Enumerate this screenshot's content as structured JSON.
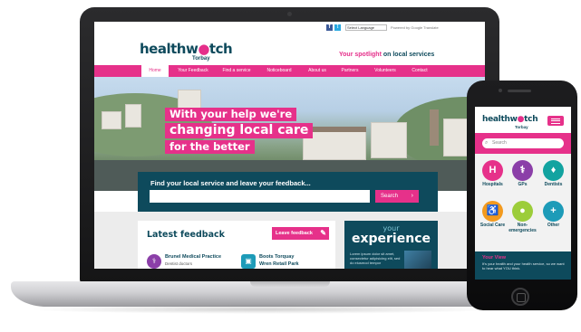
{
  "desktop": {
    "social": {
      "facebook": "f",
      "twitter": "t"
    },
    "language_select": "Select Language",
    "google_translate": "Powered by Google Translate",
    "logo": {
      "part1": "healthw",
      "mark": "●",
      "part2": "tch",
      "sub": "Torbay"
    },
    "tagline": {
      "highlight": "Your spotlight",
      "rest": " on local services"
    },
    "nav": [
      "Home",
      "Your Feedback",
      "Find a service",
      "Noticeboard",
      "About us",
      "Partners",
      "Volunteers",
      "Contact"
    ],
    "hero": {
      "line1": "With your help we're",
      "line2": "changing local care",
      "line3": "for the better"
    },
    "search": {
      "label": "Find your local service and leave your feedback...",
      "placeholder": "",
      "button": "Search",
      "button_chevron": "›"
    },
    "feedback": {
      "title": "Latest feedback",
      "leave_button": "Leave feedback",
      "entries": [
        {
          "name": "Brunel Medical Practice",
          "sub": "Dentist doctors"
        },
        {
          "name": "Boots Torquay",
          "sub": "Wren Retail Park"
        }
      ]
    },
    "experience": {
      "your": "your",
      "big": "experience",
      "text": "Lorem ipsum dolor sit amet, consectetur adipisicing elit, sed do eiusmod tempor"
    }
  },
  "mobile": {
    "logo": {
      "part1": "healthw",
      "mark": "●",
      "part2": "tch",
      "sub": "Torbay"
    },
    "search_placeholder": "Search",
    "services": [
      {
        "label": "Hospitals",
        "glyph": "H",
        "color": "#e6318a"
      },
      {
        "label": "GPs",
        "glyph": "⚕",
        "color": "#8b3fa8"
      },
      {
        "label": "Dentists",
        "glyph": "♦",
        "color": "#12a3a0"
      },
      {
        "label": "Social Care",
        "glyph": "♿",
        "color": "#f39a1e"
      },
      {
        "label": "Non-emergencies",
        "glyph": "●",
        "color": "#9ccd3a"
      },
      {
        "label": "Other",
        "glyph": "+",
        "color": "#1d9bb8"
      }
    ],
    "your_view": {
      "title": "Your View",
      "text": "It's your health and your health service, so we want to hear what YOU think."
    }
  },
  "colors": {
    "brand_pink": "#e6318a",
    "brand_navy": "#0e4a5c"
  }
}
